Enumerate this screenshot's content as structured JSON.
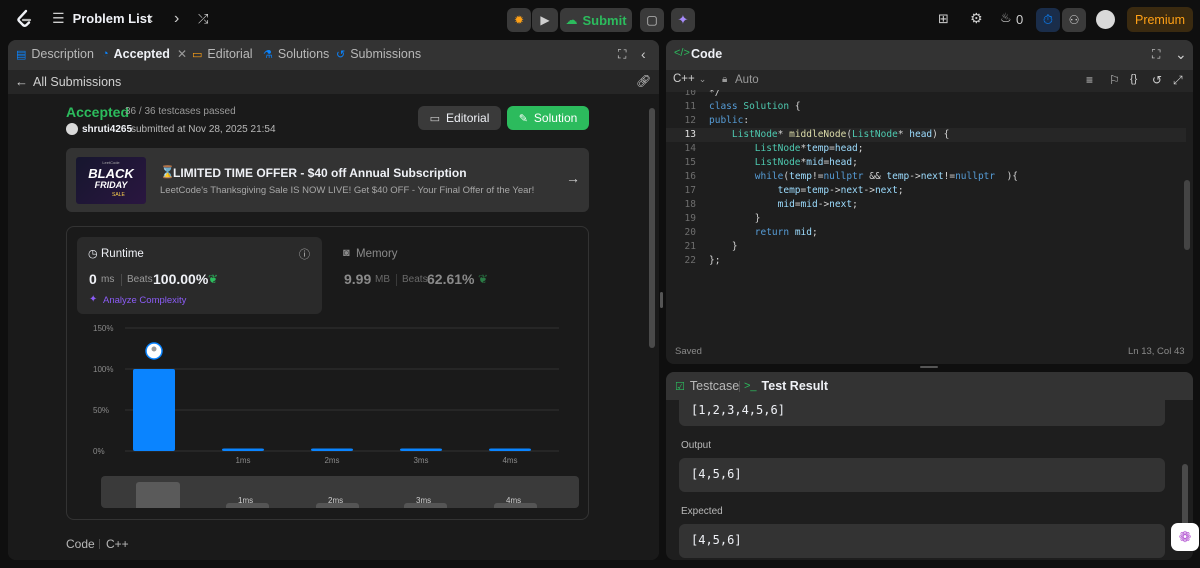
{
  "nav": {
    "problem_list": "Problem List",
    "submit": "Submit",
    "coins": "0",
    "premium": "Premium"
  },
  "left_tabs": {
    "description": "Description",
    "accepted": "Accepted",
    "editorial": "Editorial",
    "solutions": "Solutions",
    "submissions": "Submissions"
  },
  "submission": {
    "back": "All Submissions",
    "status": "Accepted",
    "testcases": "36 / 36 testcases passed",
    "user": "shruti4265",
    "submitted_at": "submitted at Nov 28, 2025 21:54",
    "editorial_btn": "Editorial",
    "solution_btn": "Solution"
  },
  "promo": {
    "brand": "LeetCode",
    "img_line1": "BLACK",
    "img_line2": "FRIDAY",
    "img_line3": "SALE",
    "title": "LIMITED TIME OFFER - $40 off Annual Subscription",
    "subtitle": "LeetCode's Thanksgiving Sale IS NOW LIVE! Get $40 OFF - Your Final Offer of the Year!"
  },
  "stats": {
    "runtime_label": "Runtime",
    "runtime_value": "0",
    "runtime_unit": "ms",
    "beats_label": "Beats",
    "runtime_beats": "100.00%",
    "analyze": "Analyze Complexity",
    "memory_label": "Memory",
    "memory_value": "9.99",
    "memory_unit": "MB",
    "memory_beats": "62.61%"
  },
  "chart_data": {
    "type": "bar",
    "categories": [
      "",
      "1ms",
      "2ms",
      "3ms",
      "4ms"
    ],
    "values": [
      100,
      3,
      3,
      3,
      3
    ],
    "ylim": [
      0,
      150
    ],
    "y_ticks": [
      "0%",
      "50%",
      "100%",
      "150%"
    ],
    "highlight_index": 0,
    "accent": "#0a84ff",
    "grid": true
  },
  "range_labels": [
    "1ms",
    "2ms",
    "3ms",
    "4ms"
  ],
  "code_section": {
    "label": "Code",
    "lang": "C++"
  },
  "editor": {
    "title": "Code",
    "lang": "C++",
    "auto": "Auto",
    "status": "Saved",
    "cursor": "Ln 13, Col 43",
    "lines": [
      {
        "n": "10",
        "t": "*/"
      },
      {
        "n": "11",
        "t": "class Solution {"
      },
      {
        "n": "12",
        "t": "public:"
      },
      {
        "n": "13",
        "t": "    ListNode* middleNode(ListNode* head) {"
      },
      {
        "n": "14",
        "t": "        ListNode*temp=head;"
      },
      {
        "n": "15",
        "t": "        ListNode*mid=head;"
      },
      {
        "n": "16",
        "t": "        while(temp!=nullptr && temp->next!=nullptr  ){"
      },
      {
        "n": "17",
        "t": "            temp=temp->next->next;"
      },
      {
        "n": "18",
        "t": "            mid=mid->next;"
      },
      {
        "n": "19",
        "t": "        }"
      },
      {
        "n": "20",
        "t": "        return mid;"
      },
      {
        "n": "21",
        "t": "    }"
      },
      {
        "n": "22",
        "t": "};"
      }
    ]
  },
  "test": {
    "tab_testcase": "Testcase",
    "tab_result": "Test Result",
    "input_value": "[1,2,3,4,5,6]",
    "output_label": "Output",
    "output_value": "[4,5,6]",
    "expected_label": "Expected",
    "expected_value": "[4,5,6]"
  },
  "colors": {
    "accent_green": "#2cbb5d",
    "accent_blue": "#0a84ff",
    "premium": "#ffa116"
  }
}
